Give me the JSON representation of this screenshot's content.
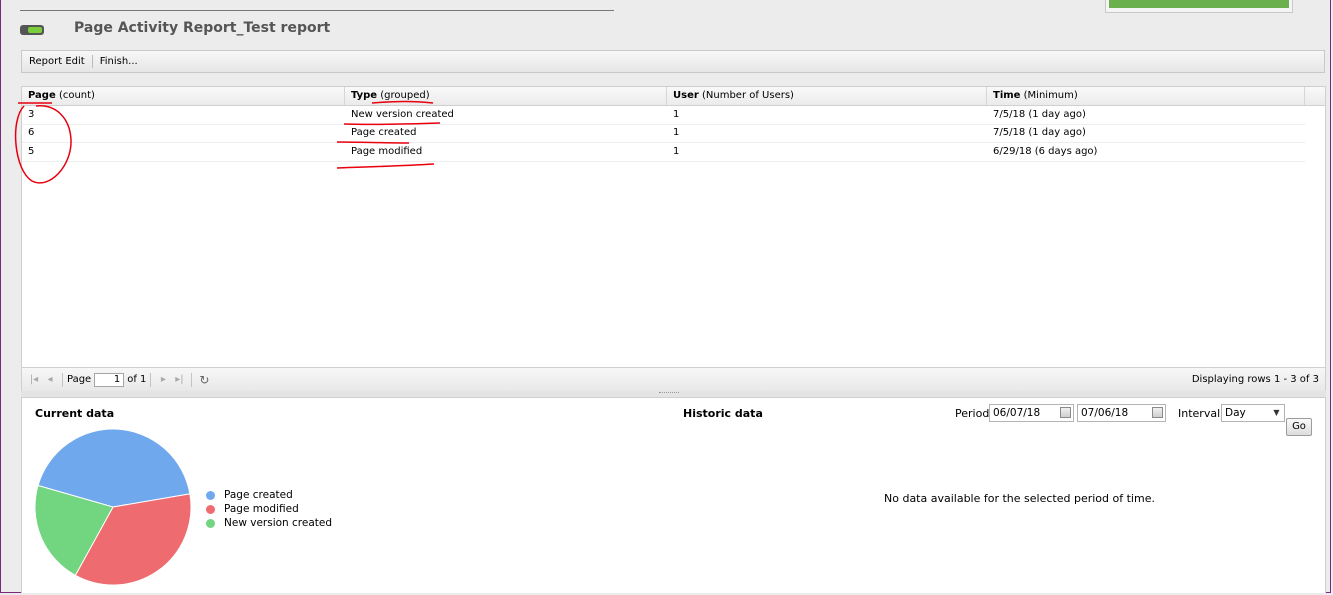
{
  "header": {
    "title": "Page Activity Report_Test report"
  },
  "toolbar": {
    "report_edit": "Report Edit",
    "finish": "Finish..."
  },
  "grid": {
    "columns": [
      {
        "name": "Page",
        "sub": "(count)"
      },
      {
        "name": "Type",
        "sub": "(grouped)"
      },
      {
        "name": "User",
        "sub": "(Number of Users)"
      },
      {
        "name": "Time",
        "sub": "(Minimum)"
      }
    ],
    "rows": [
      {
        "page": "3",
        "type": "New version created",
        "user": "1",
        "time": "7/5/18 (1 day ago)"
      },
      {
        "page": "6",
        "type": "Page created",
        "user": "1",
        "time": "7/5/18 (1 day ago)"
      },
      {
        "page": "5",
        "type": "Page modified",
        "user": "1",
        "time": "6/29/18 (6 days ago)"
      }
    ]
  },
  "pager": {
    "page_label": "Page",
    "page_value": "1",
    "of_label": "of 1",
    "status": "Displaying rows 1 - 3 of 3",
    "icons": [
      "first-page-icon",
      "prev-page-icon",
      "next-page-icon",
      "last-page-icon",
      "refresh-icon"
    ]
  },
  "current": {
    "title": "Current data",
    "legend": [
      {
        "label": "Page created",
        "color": "#6fa8ec"
      },
      {
        "label": "Page modified",
        "color": "#ee6b70"
      },
      {
        "label": "New version created",
        "color": "#72d57f"
      }
    ]
  },
  "historic": {
    "title": "Historic data",
    "period_label": "Period",
    "from": "06/07/18",
    "to": "07/06/18",
    "interval_label": "Interval",
    "interval_value": "Day",
    "go_label": "Go",
    "no_data": "No data available for the selected period of time."
  },
  "chart_data": {
    "type": "pie",
    "categories": [
      "Page created",
      "Page modified",
      "New version created"
    ],
    "values": [
      6,
      5,
      3
    ],
    "colors": [
      "#6fa8ec",
      "#ee6b70",
      "#72d57f"
    ],
    "legend_position": "right"
  }
}
